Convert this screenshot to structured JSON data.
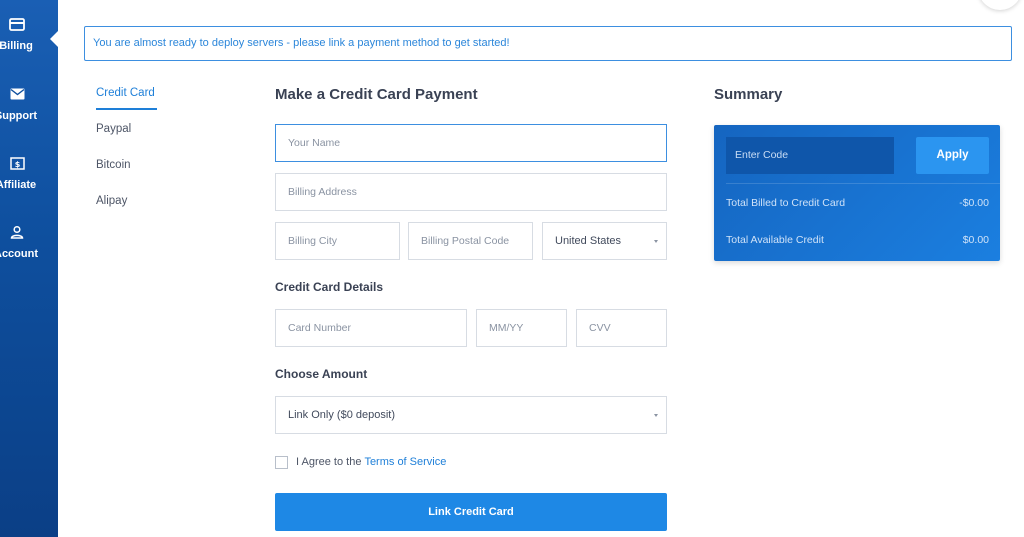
{
  "nav": {
    "items": [
      {
        "label": "Billing",
        "icon": "credit-card-icon",
        "active": true
      },
      {
        "label": "Support",
        "icon": "envelope-icon",
        "active": false
      },
      {
        "label": "Affiliate",
        "icon": "dollar-icon",
        "active": false
      },
      {
        "label": "Account",
        "icon": "user-icon",
        "active": false
      }
    ],
    "colors": {
      "rail": "#0e4f9e",
      "accent": "#1e88e5"
    }
  },
  "alert": {
    "text": "You are almost ready to deploy servers - please link a payment method to get started!"
  },
  "methods": {
    "items": [
      "Credit Card",
      "Paypal",
      "Bitcoin",
      "Alipay"
    ],
    "selected": "Credit Card"
  },
  "form": {
    "title": "Make a Credit Card Payment",
    "name_placeholder": "Your Name",
    "address_placeholder": "Billing Address",
    "city_placeholder": "Billing City",
    "postal_placeholder": "Billing Postal Code",
    "country_value": "United States",
    "card_section_title": "Credit Card Details",
    "card_number_placeholder": "Card Number",
    "expiry_placeholder": "MM/YY",
    "cvv_placeholder": "CVV",
    "amount_section_title": "Choose Amount",
    "amount_value": "Link Only ($0 deposit)",
    "agree_text": "I Agree to the",
    "tos_link": "Terms of Service",
    "submit_label": "Link Credit Card"
  },
  "summary": {
    "title": "Summary",
    "code_placeholder": "Enter Code",
    "apply_label": "Apply",
    "rows": [
      {
        "label": "Total Billed to Credit Card",
        "value": "-$0.00"
      },
      {
        "label": "Total Available Credit",
        "value": "$0.00"
      }
    ]
  }
}
